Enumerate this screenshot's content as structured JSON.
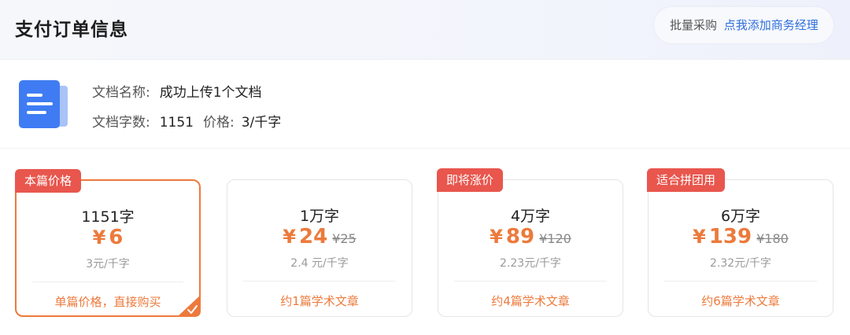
{
  "header": {
    "title": "支付订单信息",
    "bulk_label": "批量采购",
    "bulk_link": "点我添加商务经理"
  },
  "document": {
    "icon": "document-icon",
    "name_label": "文档名称:",
    "name_value": "成功上传1个文档",
    "count_label": "文档字数:",
    "count_value": "1151",
    "price_label": "价格:",
    "price_value": "3/千字"
  },
  "plans": [
    {
      "badge": "本篇价格",
      "words": "1151字",
      "currency": "¥",
      "price": "6",
      "old_price": "",
      "unit": "3元/千字",
      "footer": "单篇价格，直接购买",
      "selected": true
    },
    {
      "badge": "",
      "words": "1万字",
      "currency": "¥",
      "price": "24",
      "old_price": "¥25",
      "unit": "2.4 元/千字",
      "footer": "约1篇学术文章",
      "selected": false
    },
    {
      "badge": "即将涨价",
      "words": "4万字",
      "currency": "¥",
      "price": "89",
      "old_price": "¥120",
      "unit": "2.23元/千字",
      "footer": "约4篇学术文章",
      "selected": false
    },
    {
      "badge": "适合拼团用",
      "words": "6万字",
      "currency": "¥",
      "price": "139",
      "old_price": "¥180",
      "unit": "2.32元/千字",
      "footer": "约6篇学术文章",
      "selected": false
    }
  ],
  "colors": {
    "accent": "#ec7a3c",
    "badge": "#e8564d",
    "link": "#2f6fdd",
    "doc_icon": "#3f7cf3"
  }
}
